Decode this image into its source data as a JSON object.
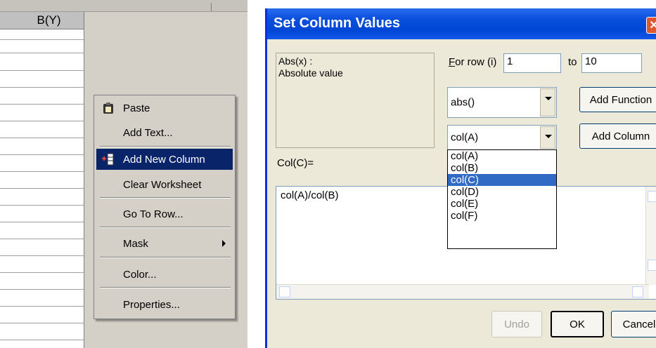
{
  "worksheet": {
    "column_header": "B(Y)"
  },
  "context_menu": {
    "items": [
      {
        "label": "Paste",
        "icon": "clipboard-icon"
      },
      {
        "label": "Add Text..."
      },
      {
        "label": "Add New Column",
        "icon": "add-column-icon",
        "selected": true
      },
      {
        "label": "Clear Worksheet"
      },
      {
        "label": "Go To Row..."
      },
      {
        "label": "Mask"
      },
      {
        "label": "Color..."
      },
      {
        "label": "Properties..."
      }
    ]
  },
  "dialog": {
    "title": "Set Column Values",
    "close_icon": "close-icon",
    "description_title": "Abs(x) :",
    "description_text": "Absolute value",
    "for_row_label": "For row (i)",
    "for_row_value": "1",
    "to_label": "to",
    "to_value": "10",
    "function_combo_value": "abs()",
    "add_function_label": "Add Function",
    "column_combo_value": "col(A)",
    "add_column_label": "Add Column",
    "column_list": [
      "col(A)",
      "col(B)",
      "col(C)",
      "col(D)",
      "col(E)",
      "col(F)"
    ],
    "column_list_selected": "col(C)",
    "col_label": "Col(C)=",
    "formula": "col(A)/col(B)",
    "undo_label": "Undo",
    "ok_label": "OK",
    "cancel_label": "Cancel",
    "colors": {
      "title_bar": "#0a4fdc",
      "selection": "#316ac5",
      "menu_selection": "#0a246a"
    }
  }
}
